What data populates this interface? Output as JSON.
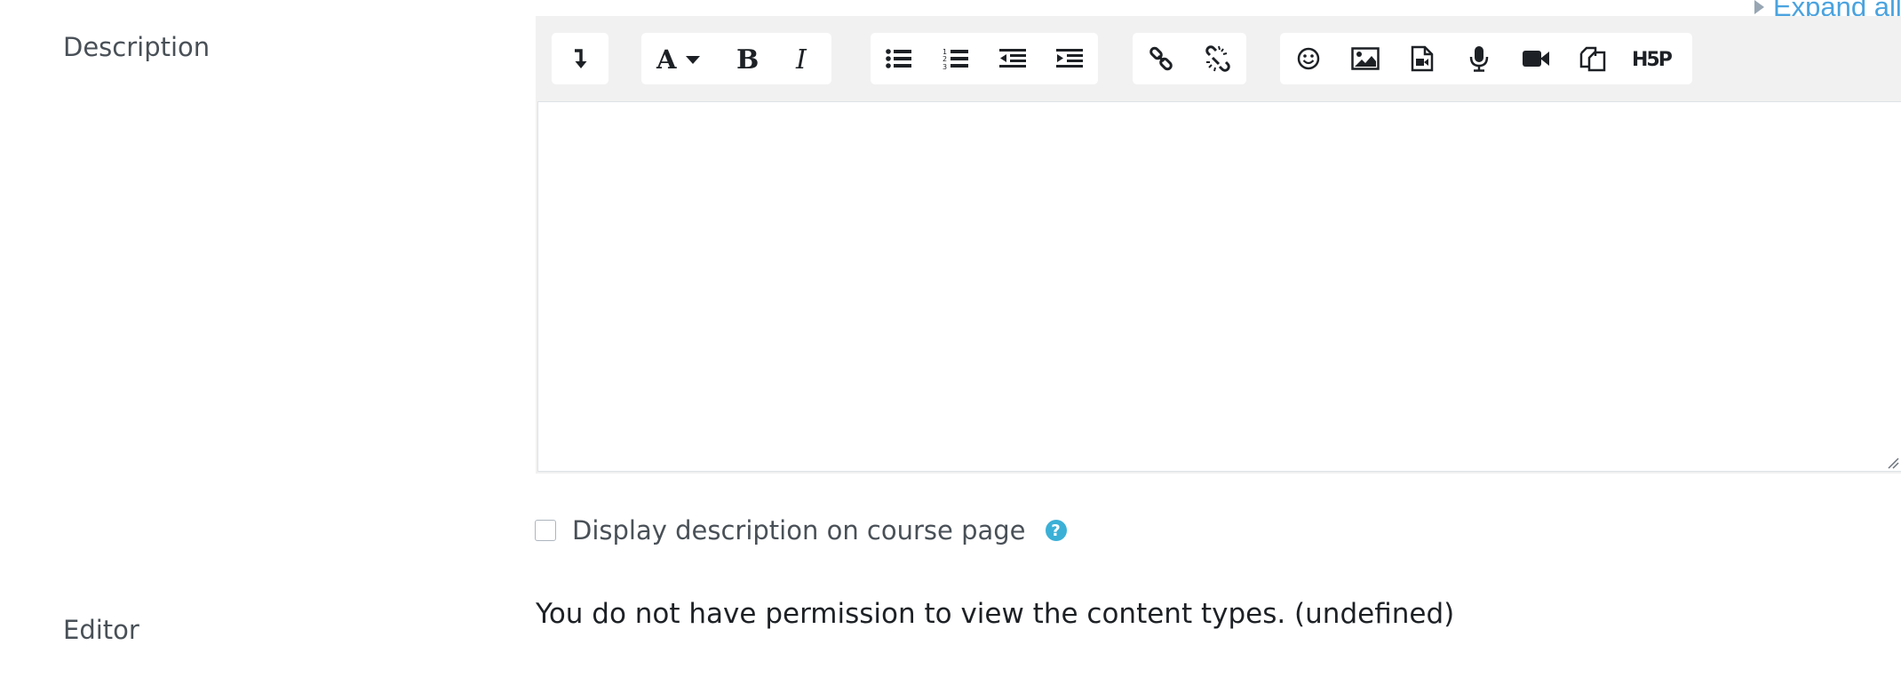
{
  "header": {
    "expand_all": "Expand all"
  },
  "form": {
    "description_label": "Description",
    "editor_label": "Editor",
    "display_description_label": "Display description on course page",
    "permission_message": "You do not have permission to view the content types. (undefined)"
  },
  "toolbar": {
    "groups": [
      {
        "name": "collapse",
        "buttons": [
          "collapse-toolbar-icon"
        ]
      },
      {
        "name": "style",
        "buttons": [
          "paragraph-styles-icon",
          "bold-icon",
          "italic-icon"
        ]
      },
      {
        "name": "list",
        "buttons": [
          "unordered-list-icon",
          "ordered-list-icon",
          "outdent-icon",
          "indent-icon"
        ]
      },
      {
        "name": "links",
        "buttons": [
          "link-icon",
          "unlink-icon"
        ]
      },
      {
        "name": "files",
        "buttons": [
          "emoji-icon",
          "image-icon",
          "media-icon",
          "record-audio-icon",
          "record-video-icon",
          "manage-files-icon",
          "h5p-icon"
        ]
      }
    ],
    "h5p_label": "H5P"
  },
  "colors": {
    "link": "#4aa3df",
    "toolbar_bg": "#f1f1f1",
    "help_icon": "#3bb0d6"
  }
}
